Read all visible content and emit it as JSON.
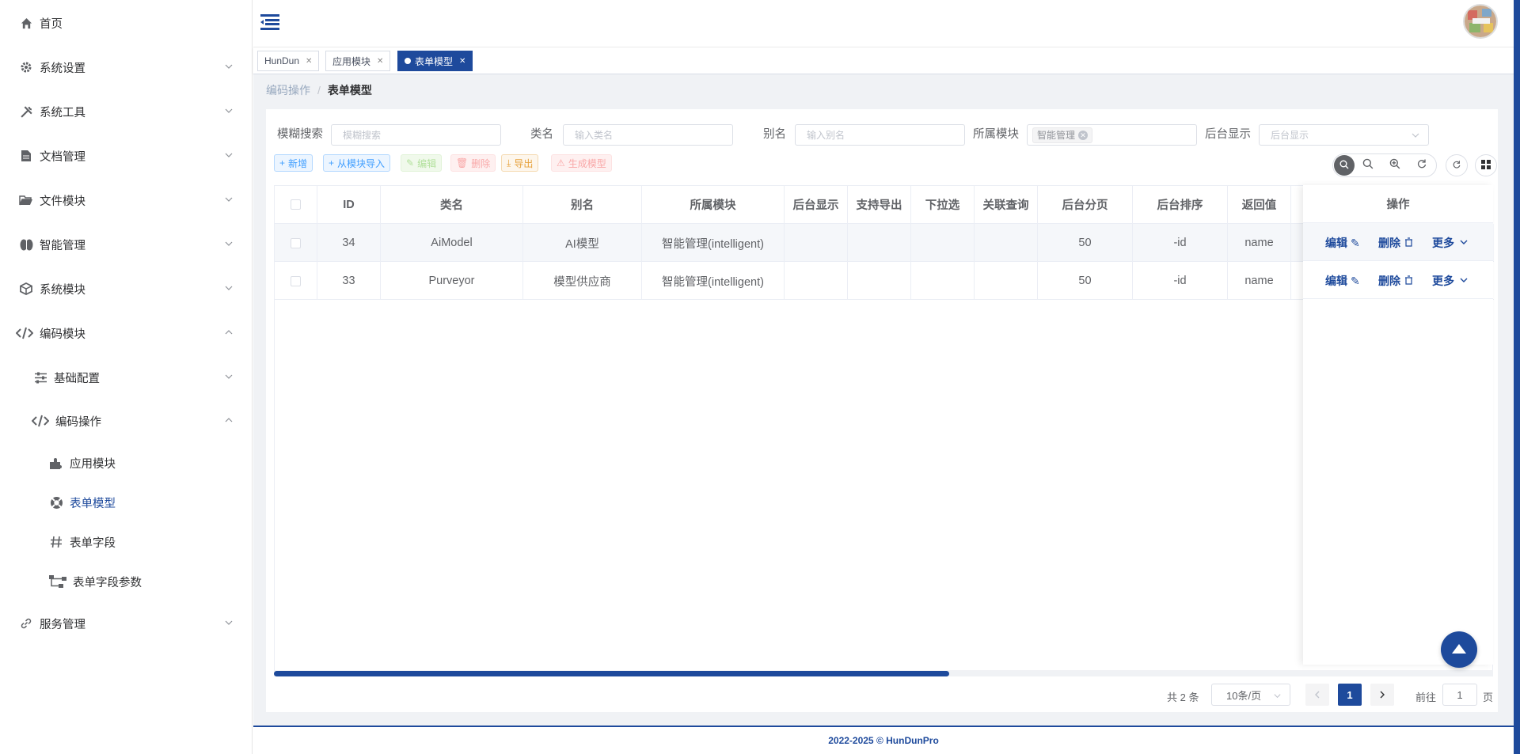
{
  "sidebar": {
    "items": [
      {
        "label": "首页",
        "icon": "home-icon"
      },
      {
        "label": "系统设置",
        "icon": "gear-icon"
      },
      {
        "label": "系统工具",
        "icon": "tools-icon"
      },
      {
        "label": "文档管理",
        "icon": "document-icon"
      },
      {
        "label": "文件模块",
        "icon": "folder-icon"
      },
      {
        "label": "智能管理",
        "icon": "brain-icon"
      },
      {
        "label": "系统模块",
        "icon": "cube-icon"
      },
      {
        "label": "编码模块",
        "icon": "code-icon"
      },
      {
        "label": "基础配置",
        "icon": "sliders-icon"
      },
      {
        "label": "编码操作",
        "icon": "code-icon"
      },
      {
        "label": "应用模块",
        "icon": "puzzle-icon"
      },
      {
        "label": "表单模型",
        "icon": "lifebuoy-icon"
      },
      {
        "label": "表单字段",
        "icon": "hash-icon"
      },
      {
        "label": "表单字段参数",
        "icon": "tree-icon"
      },
      {
        "label": "服务管理",
        "icon": "link-icon"
      }
    ]
  },
  "tabs": [
    {
      "label": "HunDun"
    },
    {
      "label": "应用模块"
    },
    {
      "label": "表单模型"
    }
  ],
  "breadcrumb": {
    "parent": "编码操作",
    "current": "表单模型"
  },
  "filters": {
    "fuzzy_label": "模糊搜索",
    "fuzzy_placeholder": "模糊搜索",
    "classname_label": "类名",
    "classname_placeholder": "输入类名",
    "alias_label": "别名",
    "alias_placeholder": "输入别名",
    "module_label": "所属模块",
    "module_value": "智能管理",
    "backend_label": "后台显示",
    "backend_placeholder": "后台显示"
  },
  "toolbar": {
    "add": "新增",
    "import": "从模块导入",
    "edit": "编辑",
    "delete": "删除",
    "export": "导出",
    "generate": "生成模型"
  },
  "table": {
    "headers": [
      "ID",
      "类名",
      "别名",
      "所属模块",
      "后台显示",
      "支持导出",
      "下拉选",
      "关联查询",
      "后台分页",
      "后台排序",
      "返回值",
      "操作"
    ],
    "rows": [
      {
        "id": "34",
        "classname": "AiModel",
        "alias": "AI模型",
        "module": "智能管理(intelligent)",
        "page": "50",
        "sort": "-id",
        "ret": "name"
      },
      {
        "id": "33",
        "classname": "Purveyor",
        "alias": "模型供应商",
        "module": "智能管理(intelligent)",
        "page": "50",
        "sort": "-id",
        "ret": "name"
      }
    ],
    "op_edit": "编辑",
    "op_delete": "删除",
    "op_more": "更多"
  },
  "pagination": {
    "total": "共 2 条",
    "page_size": "10条/页",
    "current": "1",
    "goto_label": "前往",
    "goto_value": "1",
    "goto_unit": "页"
  },
  "footer": {
    "text": "2022-2025 © HunDunPro"
  },
  "colors": {
    "primary": "#1e4a9c"
  }
}
